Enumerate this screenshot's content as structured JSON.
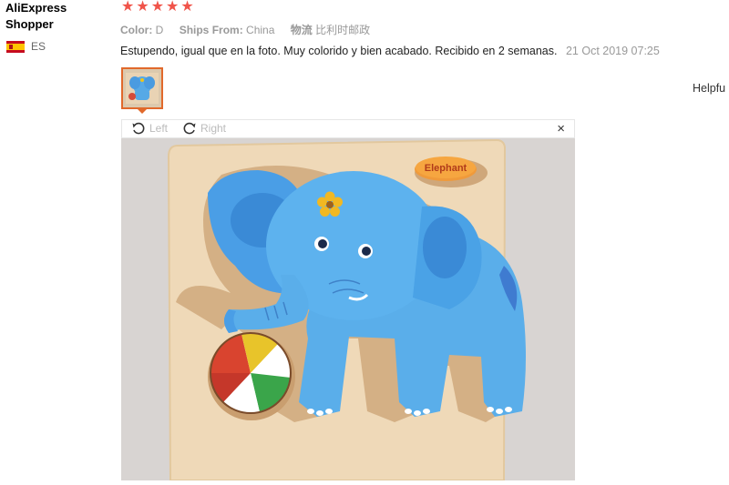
{
  "reviewer": {
    "name": "AliExpress Shopper",
    "country_code": "ES",
    "flag_icon": "spain-flag-icon"
  },
  "review": {
    "rating": 5,
    "stars": [
      "★",
      "★",
      "★",
      "★",
      "★"
    ],
    "star_color": "#f0544a",
    "meta": {
      "color_label": "Color:",
      "color_value": "D",
      "ships_label": "Ships From:",
      "ships_value": "China",
      "logistics_label": "物流",
      "logistics_value": "比利时邮政"
    },
    "text": "Estupendo, igual que en la foto. Muy colorido y bien acabado. Recibido en 2 semanas.",
    "date": "21 Oct 2019 07:25",
    "helpful_label": "Helpfu"
  },
  "viewer": {
    "rotate_left_label": "Left",
    "rotate_right_label": "Right",
    "close_label": "×",
    "photo": {
      "subject": "wooden elephant puzzle",
      "board_label": "Elephant"
    }
  }
}
